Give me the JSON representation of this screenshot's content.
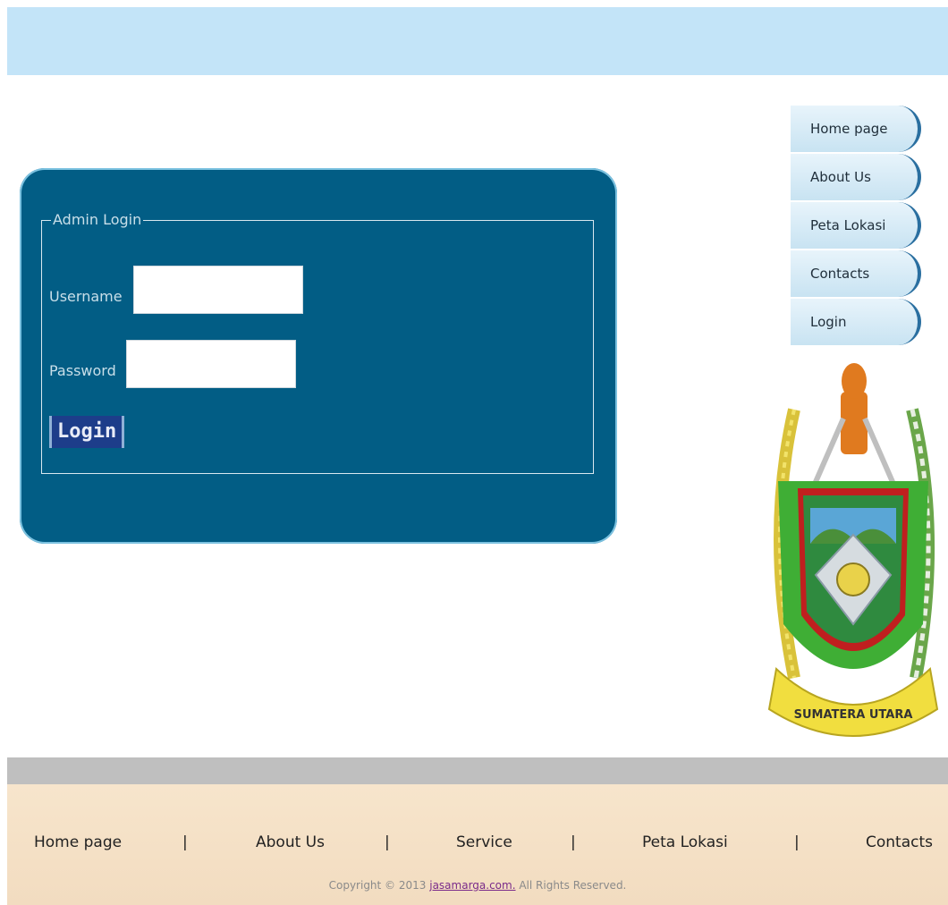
{
  "login": {
    "legend": "Admin Login",
    "username_label": "Username",
    "password_label": "Password",
    "username_value": "",
    "password_value": "",
    "button_label": "Login"
  },
  "nav": {
    "items": [
      {
        "label": "Home page"
      },
      {
        "label": "About Us"
      },
      {
        "label": "Peta Lokasi"
      },
      {
        "label": "Contacts"
      },
      {
        "label": "Login"
      }
    ]
  },
  "emblem": {
    "text": "SUMATERA UTARA"
  },
  "footer": {
    "links": [
      {
        "label": "Home page"
      },
      {
        "label": "About Us"
      },
      {
        "label": "Service"
      },
      {
        "label": "Peta Lokasi"
      },
      {
        "label": "Contacts"
      }
    ],
    "separator": "|",
    "copyright_prefix": "Copyright © 2013 ",
    "copyright_link": "jasamarga.com.",
    "copyright_suffix": " All Rights Reserved."
  },
  "colors": {
    "top_band": "#c3e4f8",
    "panel": "#025d85",
    "footer": "#f4e0c6",
    "gray_band": "#bfbfbf"
  }
}
